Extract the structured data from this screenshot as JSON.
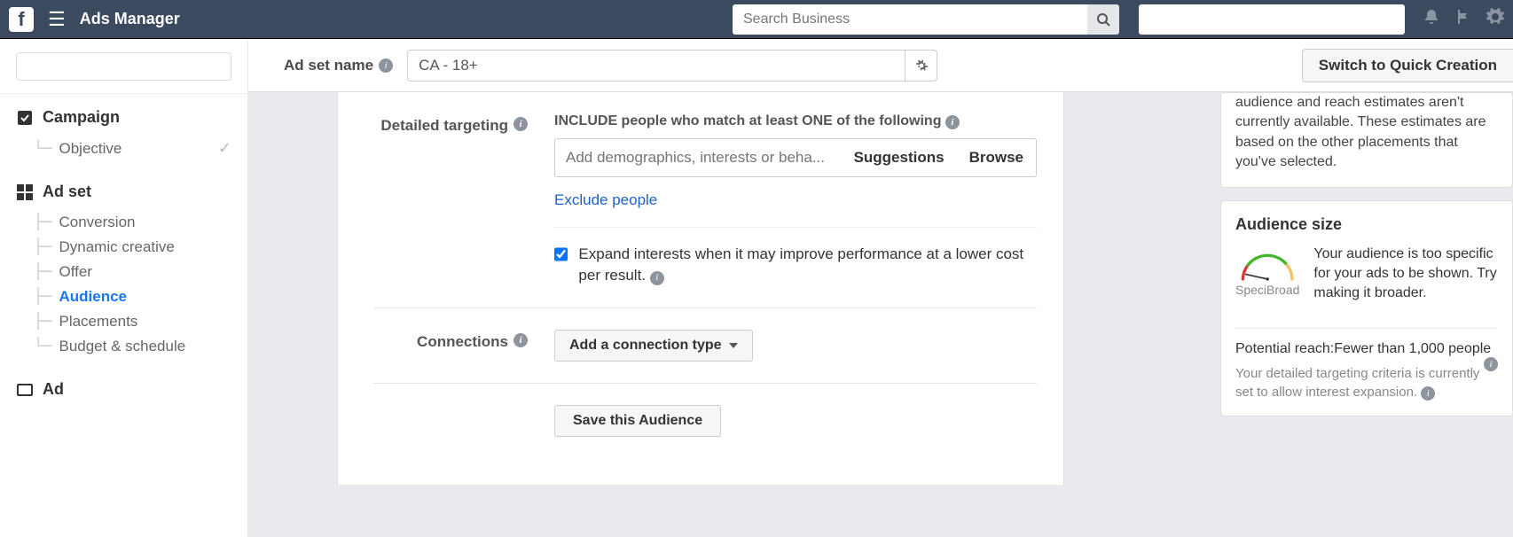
{
  "header": {
    "app_title": "Ads Manager",
    "search_placeholder": "Search Business",
    "switch_button": "Switch to Quick Creation"
  },
  "subheader": {
    "label": "Ad set name",
    "value": "CA - 18+"
  },
  "sidebar": {
    "campaign": {
      "title": "Campaign",
      "objective": "Objective"
    },
    "adset": {
      "title": "Ad set",
      "items": [
        "Conversion",
        "Dynamic creative",
        "Offer",
        "Audience",
        "Placements",
        "Budget & schedule"
      ]
    },
    "ad": {
      "title": "Ad"
    }
  },
  "form": {
    "detailed_targeting": {
      "label": "Detailed targeting",
      "include_heading": "INCLUDE people who match at least ONE of the following",
      "input_placeholder": "Add demographics, interests or beha...",
      "suggestions": "Suggestions",
      "browse": "Browse",
      "exclude": "Exclude people",
      "expand_checkbox": "Expand interests when it may improve performance at a lower cost per result."
    },
    "connections": {
      "label": "Connections",
      "button": "Add a connection type"
    },
    "save_button": "Save this Audience"
  },
  "rightpanel": {
    "estimate_note": "audience and reach estimates aren't currently available. These estimates are based on the other placements that you've selected.",
    "audience_size_title": "Audience size",
    "gauge_specific": "Speci",
    "gauge_broad": "Broad",
    "audience_msg": "Your audience is too specific for your ads to be shown. Try making it broader.",
    "reach_label": "Potential reach:",
    "reach_value": "Fewer than 1,000 people",
    "reach_note": "Your detailed targeting criteria is currently set to allow interest expansion."
  }
}
